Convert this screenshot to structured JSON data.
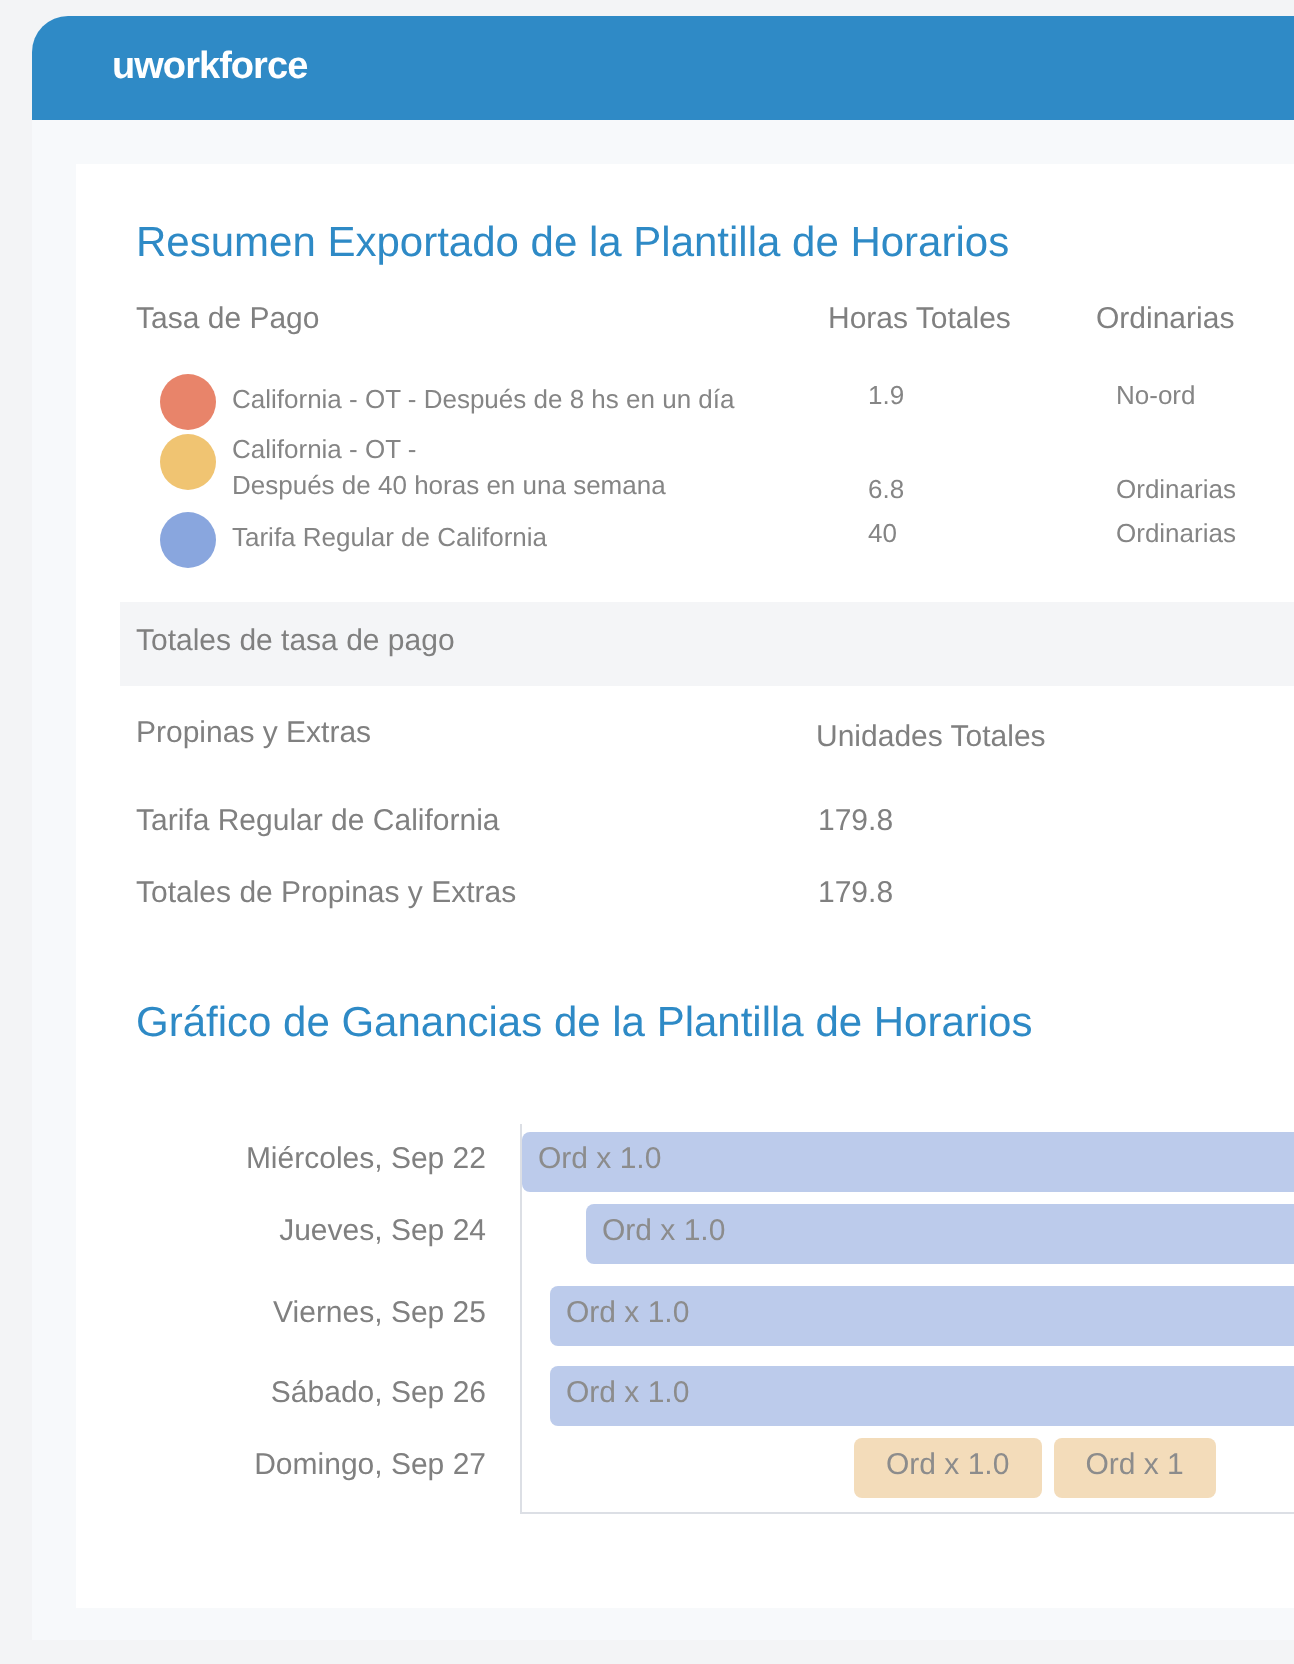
{
  "header": {
    "logo": "uworkforce"
  },
  "summary": {
    "title": "Resumen Exportado de la Plantilla de Horarios",
    "columns": [
      "Tasa de Pago",
      "Horas Totales",
      "Ordinarias"
    ],
    "rows": [
      {
        "color": "#e8846a",
        "name_lines": [
          "California - OT - Después de 8 hs en un día"
        ],
        "hours": "1.9",
        "type": "No-ord"
      },
      {
        "color": "#f0c472",
        "name_lines": [
          "California - OT -",
          "Después de 40 horas en una semana"
        ],
        "hours": "6.8",
        "type": "Ordinarias"
      },
      {
        "color": "#89a6de",
        "name_lines": [
          "Tarifa Regular de California"
        ],
        "hours": "40",
        "type": "Ordinarias"
      }
    ],
    "totals_label": "Totales de tasa de pago"
  },
  "tips": {
    "columns": [
      "Propinas y Extras",
      "Unidades Totales"
    ],
    "rows": [
      {
        "label": "Tarifa Regular de California",
        "value": "179.8"
      },
      {
        "label": "Totales de Propinas y Extras",
        "value": "179.8"
      }
    ]
  },
  "earnings_chart": {
    "title": "Gráfico de Ganancias de la Plantilla de Horarios",
    "rows": [
      {
        "day": "Miércoles, Sep 22",
        "bars": [
          {
            "label": "Ord x 1.0",
            "color": "#bccbeb"
          }
        ]
      },
      {
        "day": "Jueves, Sep 24",
        "bars": [
          {
            "label": "Ord x 1.0",
            "color": "#bccbeb"
          }
        ]
      },
      {
        "day": "Viernes, Sep 25",
        "bars": [
          {
            "label": "Ord x 1.0",
            "color": "#bccbeb"
          }
        ]
      },
      {
        "day": "Sábado, Sep 26",
        "bars": [
          {
            "label": "Ord x 1.0",
            "color": "#bccbeb"
          }
        ]
      },
      {
        "day": "Domingo, Sep 27",
        "bars": [
          {
            "label": "Ord x 1.0",
            "color": "#f3dcba"
          },
          {
            "label": "Ord x 1",
            "color": "#f3dcba"
          }
        ]
      }
    ]
  }
}
